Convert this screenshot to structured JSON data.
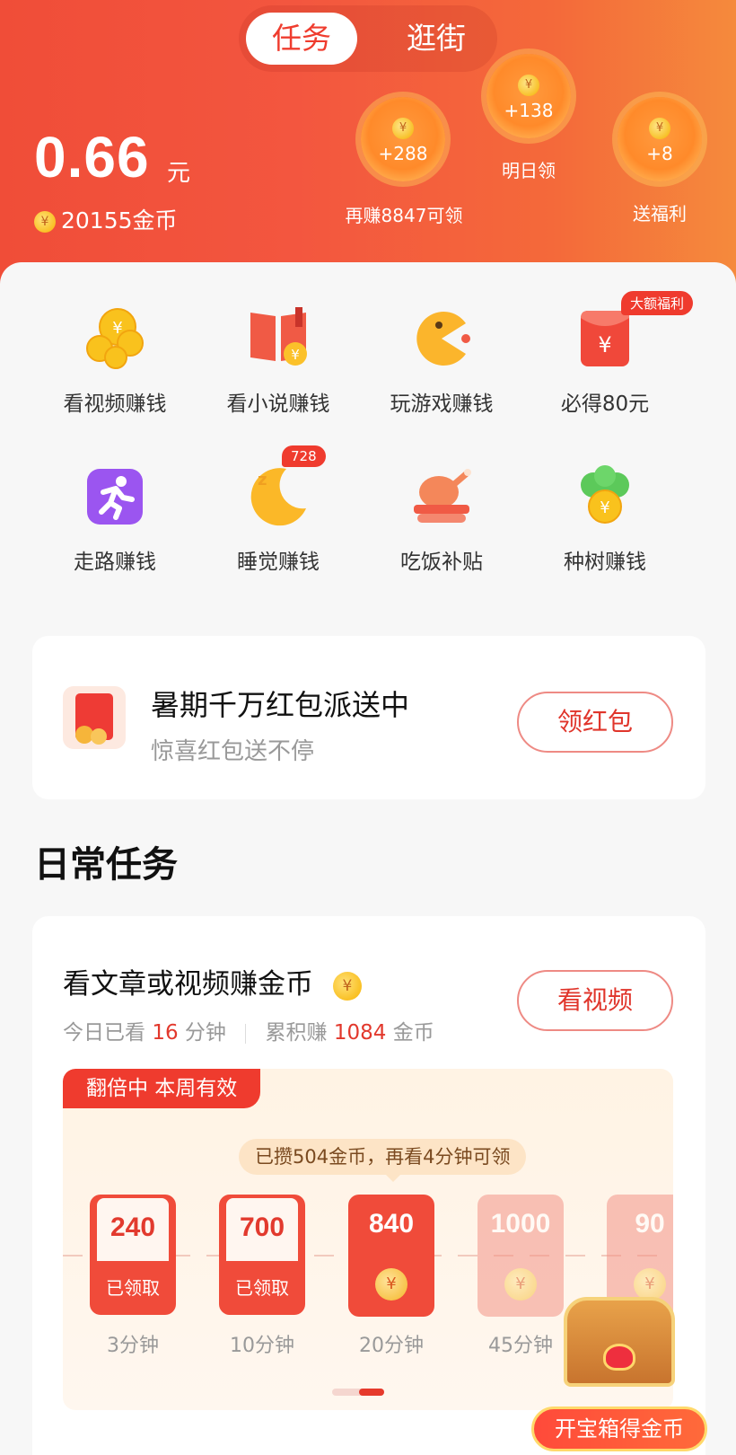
{
  "tabs": [
    {
      "label": "任务",
      "active": true
    },
    {
      "label": "逛街",
      "active": false
    }
  ],
  "wallet": {
    "balance": "0.66",
    "unit": "元",
    "coins": "20155金币"
  },
  "bubbles": [
    {
      "value": "+288",
      "caption": "再赚8847可领"
    },
    {
      "value": "+138",
      "caption": "明日领"
    },
    {
      "value": "+8",
      "caption": "送福利"
    }
  ],
  "grid": [
    {
      "label": "看视频赚钱",
      "icon": "gold-coins-icon"
    },
    {
      "label": "看小说赚钱",
      "icon": "book-icon"
    },
    {
      "label": "玩游戏赚钱",
      "icon": "pacman-icon"
    },
    {
      "label": "必得80元",
      "icon": "red-envelope-icon",
      "badge": "大额福利"
    },
    {
      "label": "走路赚钱",
      "icon": "running-icon"
    },
    {
      "label": "睡觉赚钱",
      "icon": "moon-sleep-icon",
      "badge": "728"
    },
    {
      "label": "吃饭补贴",
      "icon": "roast-chicken-icon"
    },
    {
      "label": "种树赚钱",
      "icon": "money-tree-icon"
    }
  ],
  "promo": {
    "title": "暑期千万红包派送中",
    "subtitle": "惊喜红包送不停",
    "button": "领红包"
  },
  "section_title": "日常任务",
  "task": {
    "title": "看文章或视频赚金币",
    "stats": {
      "prefix1": "今日已看",
      "watched": "16",
      "unit1": "分钟",
      "prefix2": "累积赚",
      "earned": "1084",
      "unit2": "金币"
    },
    "button": "看视频",
    "double_tag": "翻倍中 本周有效",
    "tip": "已攒504金币，再看4分钟可领",
    "milestones": [
      {
        "amount": "240",
        "status": "已领取",
        "time": "3分钟"
      },
      {
        "amount": "700",
        "status": "已领取",
        "time": "10分钟"
      },
      {
        "amount": "840",
        "status": "",
        "time": "20分钟"
      },
      {
        "amount": "1000",
        "status": "",
        "time": "45分钟"
      },
      {
        "amount": "90",
        "status": "",
        "time": ""
      }
    ]
  },
  "chest": {
    "label": "开宝箱得金币"
  },
  "colors": {
    "brand_red": "#ef3b2e",
    "header_start": "#f04d38",
    "header_end": "#f58a3c"
  }
}
